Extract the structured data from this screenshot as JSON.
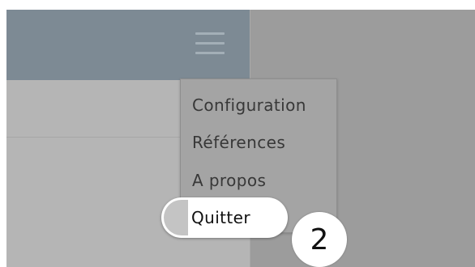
{
  "header": {
    "menu_icon": "hamburger-menu-icon"
  },
  "menu": {
    "items": [
      {
        "label": "Configuration"
      },
      {
        "label": "Références"
      },
      {
        "label": "A propos"
      },
      {
        "label": "Quitter",
        "highlighted": true
      }
    ]
  },
  "callout": {
    "step_number": "2"
  },
  "colors": {
    "header": "#7d8a94",
    "overlay": "#9c9c9c",
    "menu_background": "#a4a4a4",
    "highlight": "#ffffff"
  }
}
